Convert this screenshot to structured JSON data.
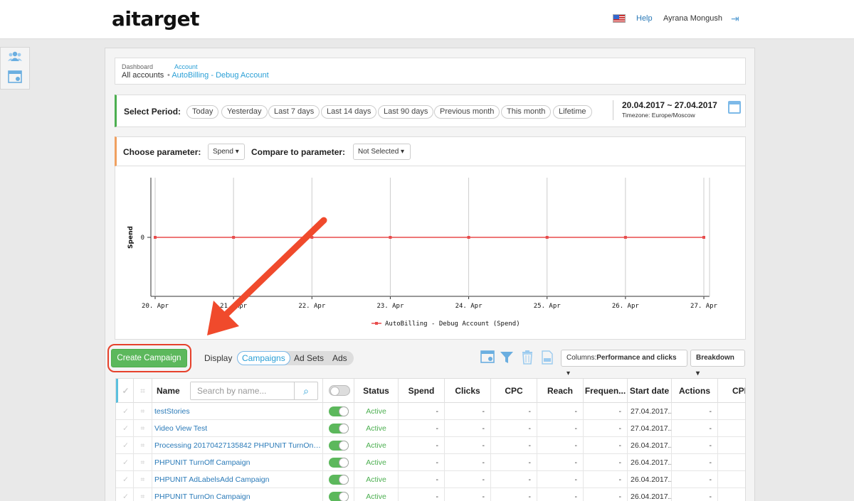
{
  "header": {
    "logo": "aitarget",
    "help": "Help",
    "user": "Ayrana Mongush"
  },
  "breadcrumb": {
    "dashboard_small": "Dashboard",
    "dashboard": "All accounts",
    "account_small": "Account",
    "account": "AutoBilling - Debug Account"
  },
  "period": {
    "label": "Select Period:",
    "options": [
      "Today",
      "Yesterday",
      "Last 7 days",
      "Last 14 days",
      "Last 90 days",
      "Previous month",
      "This month",
      "Lifetime"
    ],
    "range": "20.04.2017 ~ 27.04.2017",
    "timezone": "Timezone: Europe/Moscow"
  },
  "parameter": {
    "label": "Choose parameter:",
    "value": "Spend",
    "compare_label": "Compare to parameter:",
    "compare_value": "Not Selected"
  },
  "chart_data": {
    "type": "line",
    "x": [
      "20. Apr",
      "21. Apr",
      "22. Apr",
      "23. Apr",
      "24. Apr",
      "25. Apr",
      "26. Apr",
      "27. Apr"
    ],
    "series": [
      {
        "name": "AutoBilling - Debug Account (Spend)",
        "values": [
          0,
          0,
          0,
          0,
          0,
          0,
          0,
          0
        ]
      }
    ],
    "ylabel": "Spend",
    "yticks": [
      "0"
    ],
    "color": "#e84c4c",
    "legend": "bottom-center",
    "grid": true
  },
  "toolbar": {
    "create": "Create Campaign",
    "display": "Display",
    "tabs": [
      "Campaigns",
      "Ad Sets",
      "Ads"
    ],
    "columns_prefix": "Columns:",
    "columns_value": "Performance and clicks",
    "breakdown": "Breakdown"
  },
  "table": {
    "search_placeholder": "Search by name...",
    "headers": [
      "Name",
      "Status",
      "Spend",
      "Clicks",
      "CPC",
      "Reach",
      "Frequen...",
      "Start date",
      "Actions",
      "CPM"
    ],
    "rows": [
      {
        "name": "testStories",
        "status": "Active",
        "spend": "-",
        "clicks": "-",
        "cpc": "-",
        "reach": "-",
        "freq": "-",
        "start": "27.04.2017...",
        "actions": "-"
      },
      {
        "name": "Video View Test",
        "status": "Active",
        "spend": "-",
        "clicks": "-",
        "cpc": "-",
        "reach": "-",
        "freq": "-",
        "start": "27.04.2017...",
        "actions": "-"
      },
      {
        "name": "Processing 20170427135842 PHPUNIT TurnOn Ca...",
        "status": "Active",
        "spend": "-",
        "clicks": "-",
        "cpc": "-",
        "reach": "-",
        "freq": "-",
        "start": "26.04.2017...",
        "actions": "-"
      },
      {
        "name": "PHPUNIT TurnOff Campaign",
        "status": "Active",
        "spend": "-",
        "clicks": "-",
        "cpc": "-",
        "reach": "-",
        "freq": "-",
        "start": "26.04.2017...",
        "actions": "-"
      },
      {
        "name": "PHPUNIT AdLabelsAdd Campaign",
        "status": "Active",
        "spend": "-",
        "clicks": "-",
        "cpc": "-",
        "reach": "-",
        "freq": "-",
        "start": "26.04.2017...",
        "actions": "-"
      },
      {
        "name": "PHPUNIT TurnOn Campaign",
        "status": "Active",
        "spend": "-",
        "clicks": "-",
        "cpc": "-",
        "reach": "-",
        "freq": "-",
        "start": "26.04.2017...",
        "actions": "-"
      }
    ]
  },
  "colors": {
    "accent": "#2a9fd6",
    "create_button": "#5cb85c",
    "annotation": "#e6412b"
  }
}
